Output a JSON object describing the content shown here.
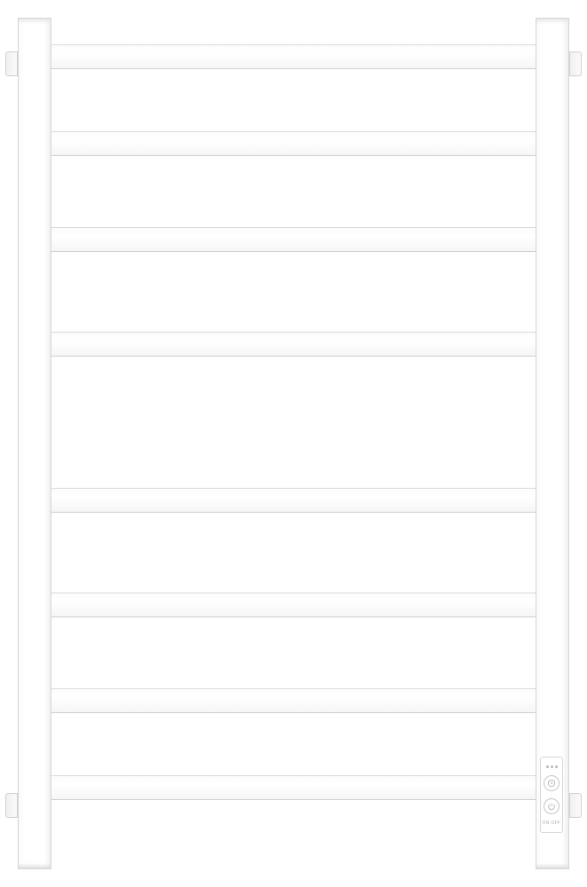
{
  "product": {
    "type": "heated-towel-rack",
    "finish": "white",
    "bars": 8,
    "controls": {
      "timer_icon": "clock",
      "power_icon": "power",
      "label": "ON·OFF"
    }
  }
}
